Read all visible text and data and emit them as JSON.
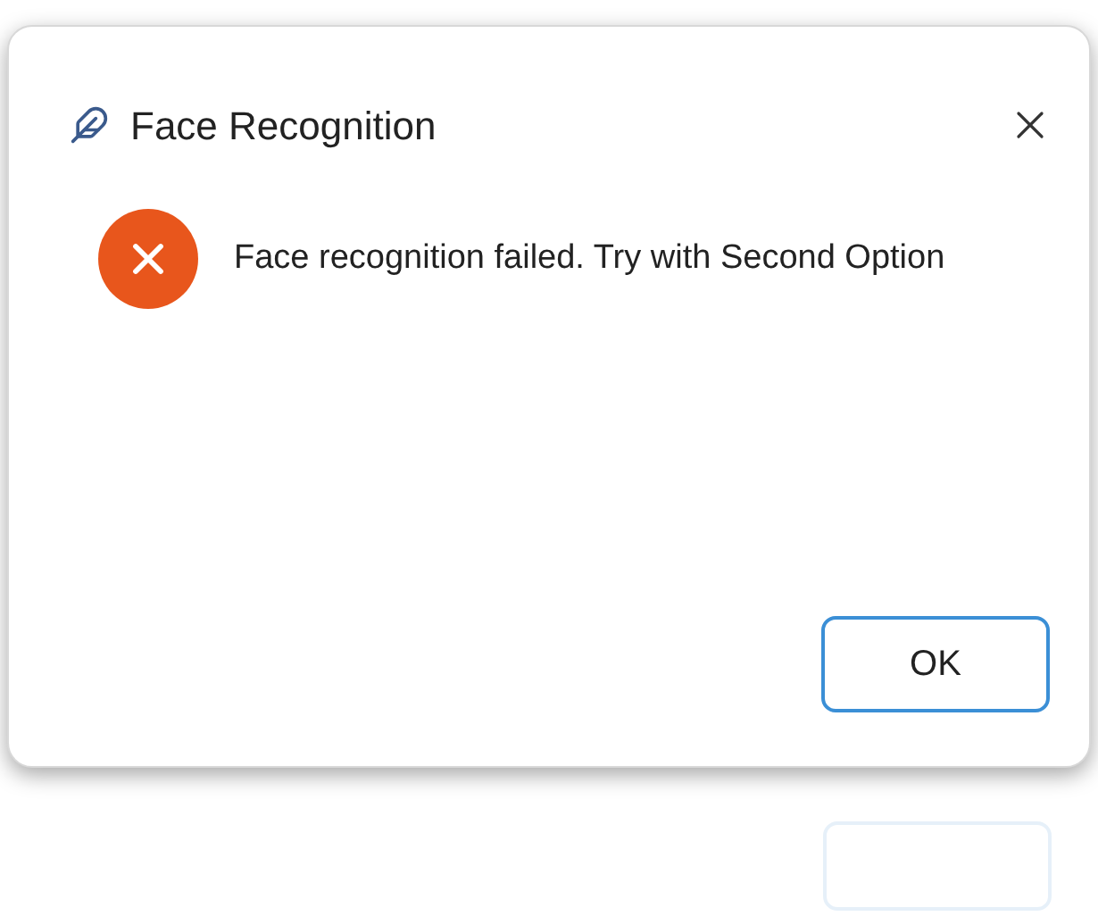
{
  "window": {
    "title": "Face Recognition"
  },
  "message": {
    "text": "Face recognition failed. Try with Second Option",
    "kind": "error"
  },
  "buttons": [
    {
      "label": "OK",
      "selected": true
    }
  ]
}
